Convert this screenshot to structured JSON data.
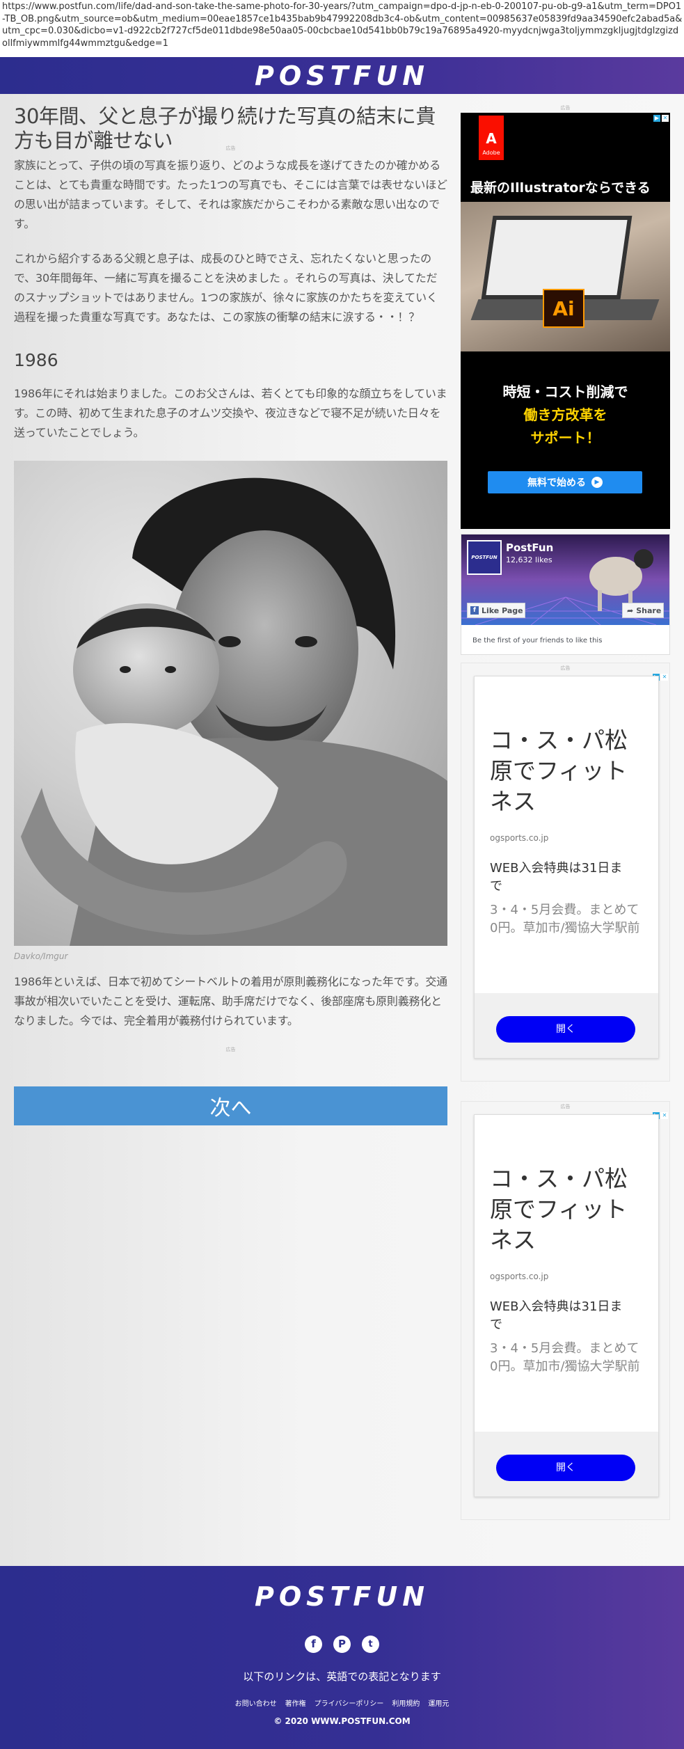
{
  "url": {
    "text": "https://www.postfun.com/life/dad-and-son-take-the-same-photo-for-30-years/?utm_campaign=dpo-d-jp-n-eb-0-200107-pu-ob-g9-a1&utm_term=DPO1-TB_OB.png&utm_source=ob&utm_medium=00eae1857ce1b435bab9b47992208db3c4-ob&utm_content=00985637e05839fd9aa34590efc2abad5a&utm_cpc=0.030&dicbo=v1-d922cb2f727cf5de011dbde98e50aa05-00cbcbae10d541bb0b79c19a76895a4920-myydcnjwga3toljymmzgkljugjtdglzgizdollfmiywmmlfg44wmmztgu&edge=1"
  },
  "header": {
    "logo": "POSTFUN"
  },
  "article": {
    "title": "30年間、父と息子が撮り続けた写真の結末に貴方も目が離せない",
    "title_ad_label": "広告",
    "intro_1": "家族にとって、子供の頃の写真を振り返り、どのような成長を遂げてきたのか確かめることは、とても貴重な時間です。たった1つの写真でも、そこには言葉では表せないほどの思い出が詰まっています。そして、それは家族だからこそわかる素敵な思い出なのです。",
    "intro_2": "これから紹介するある父親と息子は、成長のひと時でさえ、忘れたくないと思ったので、30年間毎年、一緒に写真を撮ることを決めました 。それらの写真は、決してただのスナップショットではありません。1つの家族が、徐々に家族のかたちを変えていく過程を撮った貴重な写真です。あなたは、この家族の衝撃の結末に涙する・・！？",
    "year_heading": "1986",
    "year_text": "1986年にそれは始まりました。このお父さんは、若くとても印象的な顔立ちをしています。この時、初めて生まれた息子のオムツ交換や、夜泣きなどで寝不足が続いた日々を送っていたことでしょう。",
    "photo_credit": "Davko/Imgur",
    "after_text": "1986年といえば、日本で初めてシートベルトの着用が原則義務化になった年です。交通事故が相次いでいたことを受け、運転席、助手席だけでなく、後部座席も原則義務化となりました。今では、完全着用が義務付けられています。",
    "bottom_ad_label": "広告",
    "next_button": "次へ"
  },
  "sidebar": {
    "ad_label": "広告",
    "adobe_ad": {
      "brand": "Adobe",
      "headline": "最新のIllustratorならできる",
      "app_icon": "Ai",
      "copy_line1": "時短・コスト削減で",
      "copy_line2": "働き方改革を",
      "copy_line3": "サポート！",
      "cta": "無料で始める"
    },
    "fb_widget": {
      "page_name": "PostFun",
      "likes": "12,632 likes",
      "like_button": "Like Page",
      "share_button": "Share",
      "friends_text": "Be the first of your friends to like this",
      "avatar_text": "POSTFUN"
    },
    "gym_ads": [
      {
        "ad_label": "広告",
        "headline": "コ・ス・パ松原でフィットネス",
        "domain": "ogsports.co.jp",
        "title": "WEB入会特典は31日まで",
        "body": "3・4・5月会費。まとめて0円。草加市/獨協大学駅前",
        "cta": "開く"
      },
      {
        "ad_label": "広告",
        "headline": "コ・ス・パ松原でフィットネス",
        "domain": "ogsports.co.jp",
        "title": "WEB入会特典は31日まで",
        "body": "3・4・5月会費。まとめて0円。草加市/獨協大学駅前",
        "cta": "開く"
      }
    ]
  },
  "footer": {
    "logo": "POSTFUN",
    "social": [
      "facebook-icon",
      "pinterest-icon",
      "twitter-icon"
    ],
    "note": "以下のリンクは、英語での表記となります",
    "links": [
      "お問い合わせ",
      "著作権",
      "プライバシーポリシー",
      "利用規約",
      "運用元"
    ],
    "copyright": "© 2020 WWW.POSTFUN.COM"
  },
  "colors": {
    "brand_purple": "#2c2d8e",
    "next_button": "#4a93d3",
    "ad_cta_blue": "#1f8cf0",
    "gym_cta_blue": "#0000f5",
    "adobe_red": "#fa0f00"
  }
}
